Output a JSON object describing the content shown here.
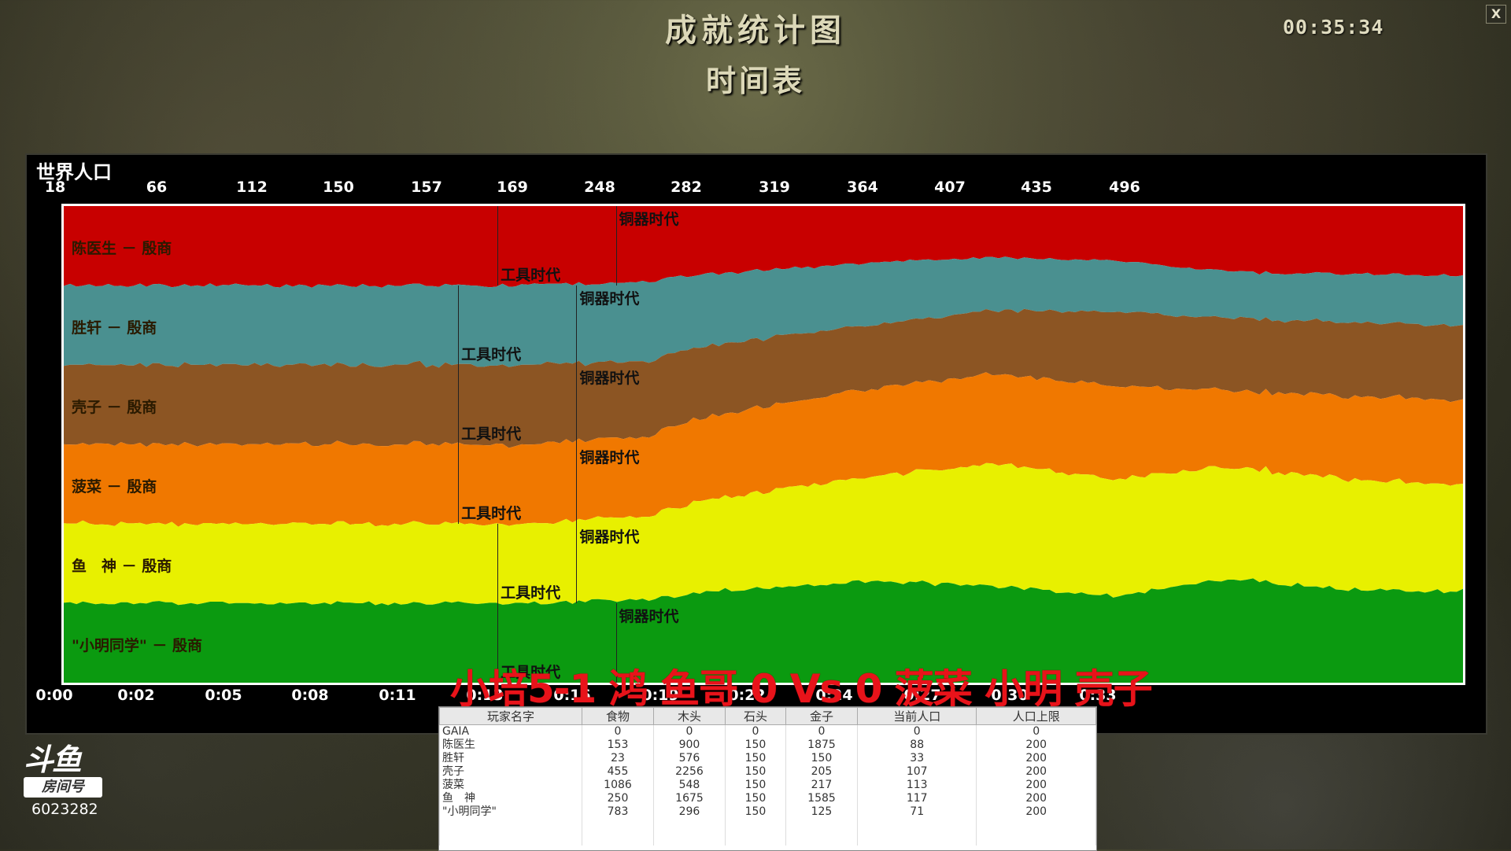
{
  "header": {
    "title": "成就统计图",
    "subtitle": "时间表",
    "clock": "00:35:34",
    "close_label": "X"
  },
  "chart_panel": {
    "title": "世界人口",
    "top_axis": [
      "18",
      "66",
      "112",
      "150",
      "157",
      "169",
      "248",
      "282",
      "319",
      "364",
      "407",
      "435",
      "496"
    ],
    "bottom_axis": [
      "0:00",
      "0:02",
      "0:05",
      "0:08",
      "0:11",
      "0:13",
      "0:16",
      "0:19",
      "0:22",
      "0:24",
      "0:27",
      "0:30",
      "0:33"
    ],
    "age_labels": {
      "tool": "工具时代",
      "bronze": "铜器时代"
    }
  },
  "chart_data": {
    "type": "area",
    "title": "世界人口",
    "xlabel": "",
    "ylabel": "",
    "x": [
      "0:00",
      "0:02",
      "0:05",
      "0:08",
      "0:11",
      "0:13",
      "0:16",
      "0:19",
      "0:22",
      "0:24",
      "0:27",
      "0:30",
      "0:33"
    ],
    "series": [
      {
        "name": "陈医生 － 殷商",
        "color": "#c80000",
        "values": [
          3,
          9,
          14,
          17,
          17,
          20,
          32,
          32,
          32,
          34,
          40,
          42,
          46
        ],
        "tool_age": "0:11",
        "bronze_age": "0:14"
      },
      {
        "name": "胜轩 － 殷商",
        "color": "#4a9090",
        "values": [
          3,
          9,
          14,
          17,
          17,
          21,
          34,
          35,
          33,
          32,
          28,
          30,
          33
        ],
        "tool_age": "0:10",
        "bronze_age": "0:13"
      },
      {
        "name": "壳子 － 殷商",
        "color": "#8c5523",
        "values": [
          3,
          9,
          14,
          17,
          17,
          20,
          34,
          36,
          40,
          46,
          44,
          46,
          49
        ],
        "tool_age": "0:10",
        "bronze_age": "0:13"
      },
      {
        "name": "菠菜 － 殷商",
        "color": "#f07800",
        "values": [
          3,
          9,
          14,
          17,
          17,
          21,
          42,
          50,
          56,
          58,
          46,
          52,
          56
        ],
        "tool_age": "0:10",
        "bronze_age": "0:13"
      },
      {
        "name": "鱼　神 － 殷商",
        "color": "#e8f000",
        "values": [
          3,
          9,
          14,
          17,
          17,
          22,
          48,
          60,
          76,
          72,
          68,
          69,
          70
        ],
        "tool_age": "0:11",
        "bronze_age": "0:13"
      },
      {
        "name": "\"小明同学\" － 殷商",
        "color": "#0b9a10",
        "values": [
          3,
          9,
          14,
          17,
          17,
          22,
          47,
          58,
          60,
          54,
          63,
          58,
          60
        ],
        "tool_age": "0:11",
        "bronze_age": "0:14"
      }
    ]
  },
  "overlay_text": "小培5-1 鸿 鱼哥 0 Vs 0 菠菜 小明 壳子",
  "stats_table": {
    "headers": [
      "玩家名字",
      "食物",
      "木头",
      "石头",
      "金子",
      "当前人口",
      "人口上限"
    ],
    "rows": [
      [
        "GAIA",
        "0",
        "0",
        "0",
        "0",
        "0",
        "0"
      ],
      [
        "陈医生",
        "153",
        "900",
        "150",
        "1875",
        "88",
        "200"
      ],
      [
        "胜轩",
        "23",
        "576",
        "150",
        "150",
        "33",
        "200"
      ],
      [
        "壳子",
        "455",
        "2256",
        "150",
        "205",
        "107",
        "200"
      ],
      [
        "菠菜",
        "1086",
        "548",
        "150",
        "217",
        "113",
        "200"
      ],
      [
        "鱼　神",
        "250",
        "1675",
        "150",
        "1585",
        "117",
        "200"
      ],
      [
        "\"小明同学\"",
        "783",
        "296",
        "150",
        "125",
        "71",
        "200"
      ]
    ]
  },
  "logo": {
    "room_label": "房间号",
    "room_number": "6023282"
  }
}
